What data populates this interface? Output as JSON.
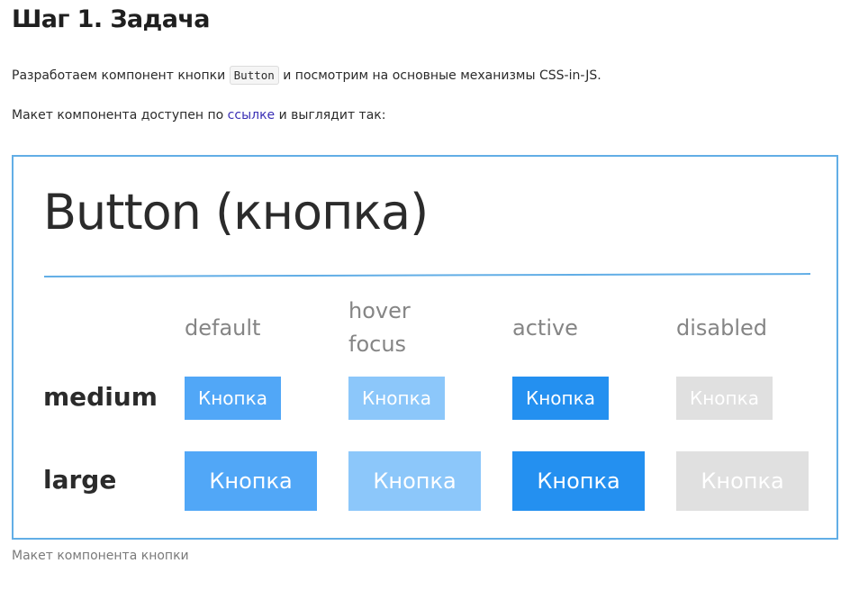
{
  "heading": "Шаг 1. Задача",
  "paragraph1": {
    "before": "Разработаем компонент кнопки ",
    "code": "Button",
    "after": " и посмотрим на основные механизмы CSS-in-JS."
  },
  "paragraph2": {
    "before": "Макет компонента доступен по ",
    "link": "ссылке",
    "after": " и выглядит так:"
  },
  "figure": {
    "title": "Button (кнопка)",
    "states": [
      {
        "label": "default"
      },
      {
        "label": "hover\nfocus"
      },
      {
        "label": "active"
      },
      {
        "label": "disabled"
      }
    ],
    "sizes": [
      {
        "label": "medium"
      },
      {
        "label": "large"
      }
    ],
    "button_label": "Кнопка",
    "colors": {
      "default": "#51a7f7",
      "hover_focus": "#8cc7fa",
      "active": "#2490f0",
      "disabled": "#e0e0e0",
      "border": "#62aee6"
    }
  },
  "caption": "Макет компонента кнопки"
}
